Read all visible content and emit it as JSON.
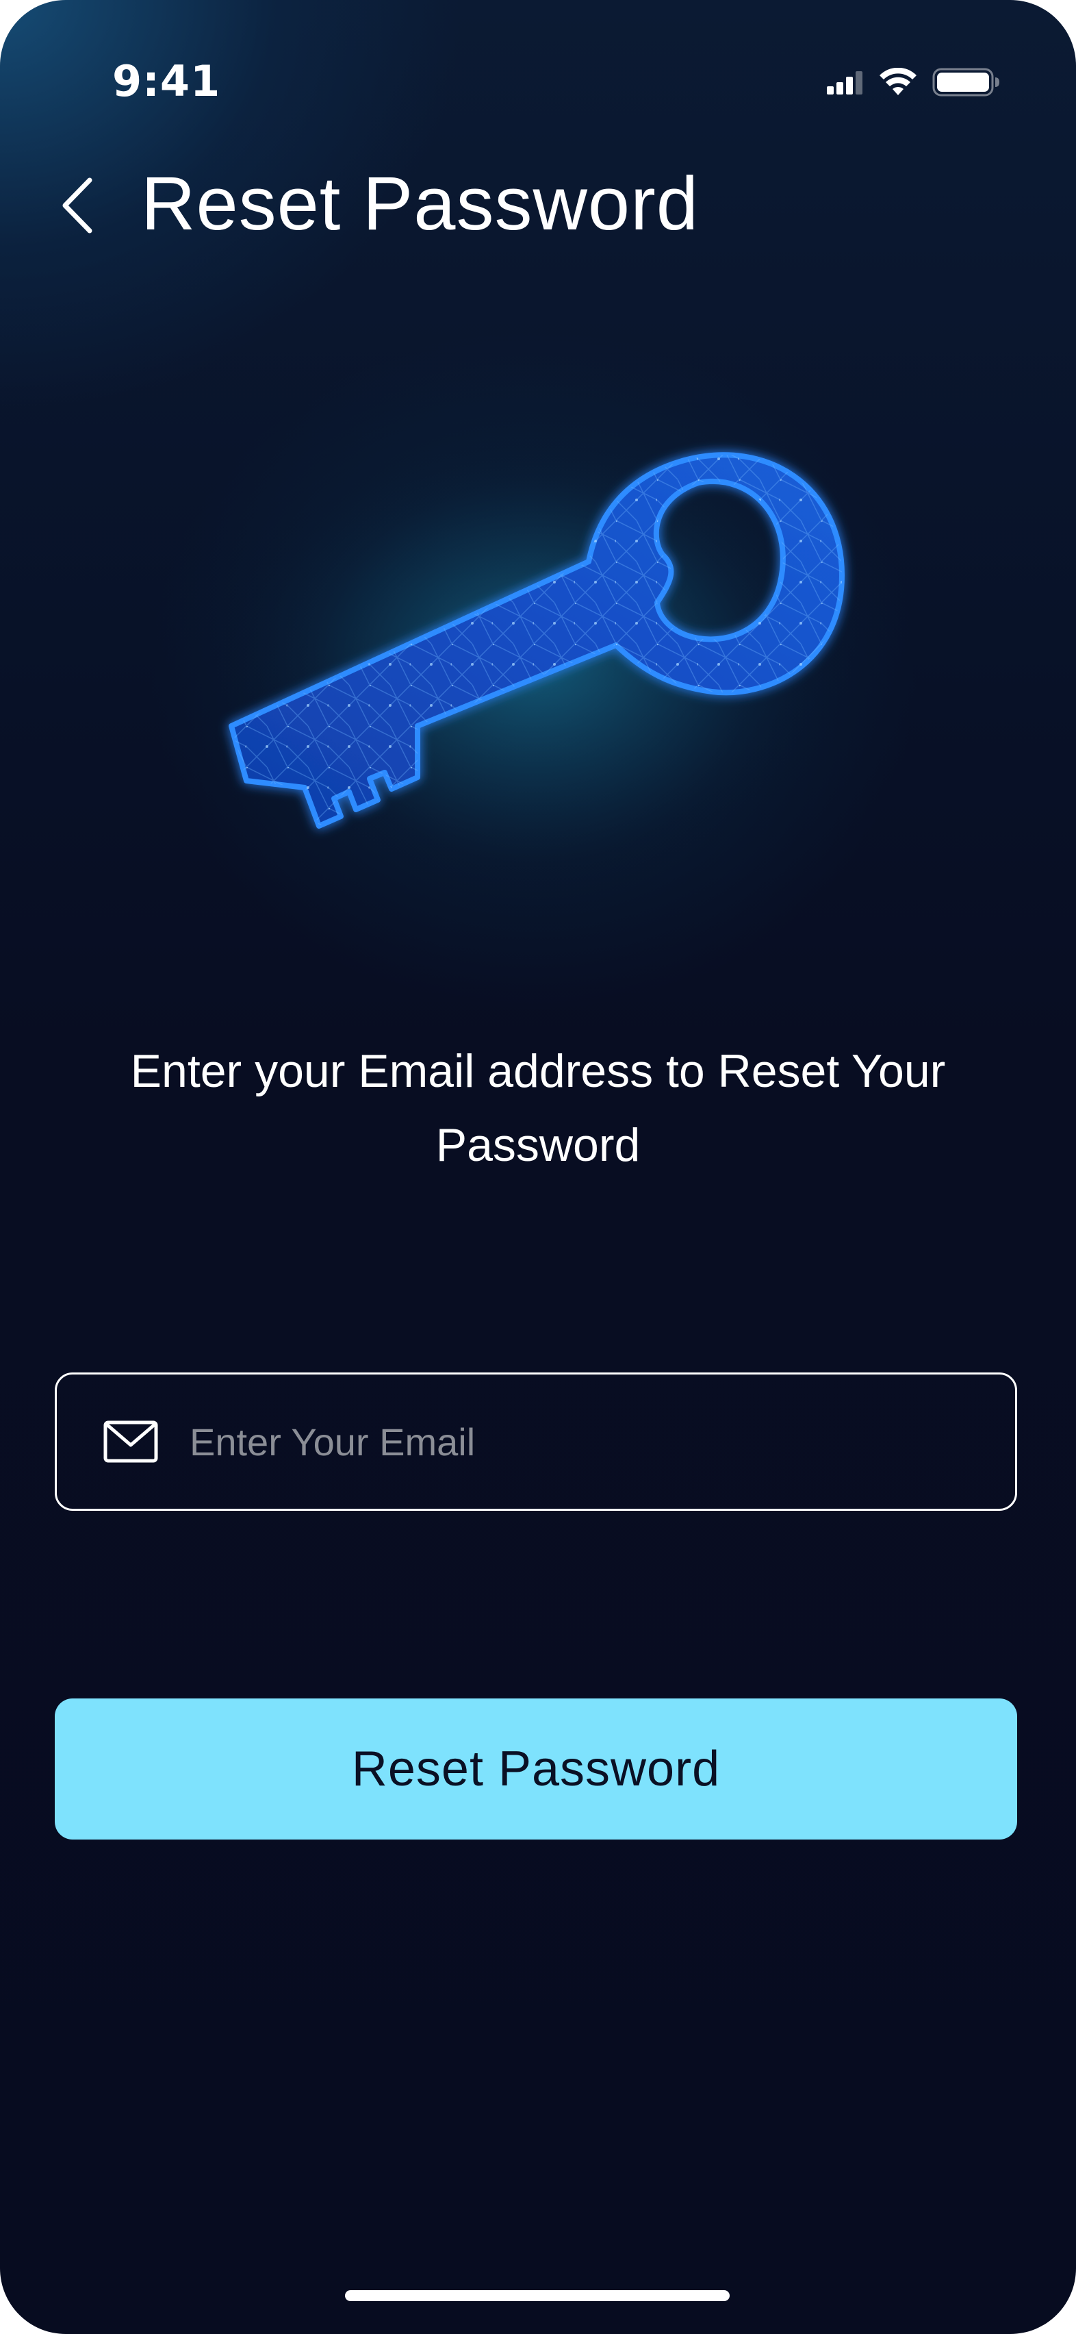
{
  "status_bar": {
    "time": "9:41",
    "icons": [
      "signal-icon",
      "wifi-icon",
      "battery-icon"
    ]
  },
  "header": {
    "back_icon": "chevron-left-icon",
    "title": "Reset Password"
  },
  "illustration": {
    "icon": "key-icon",
    "glow_color": "#1e7bff"
  },
  "instruction": {
    "text": "Enter your Email address to Reset Your Password"
  },
  "email_field": {
    "icon": "mail-icon",
    "value": "",
    "placeholder": "Enter Your Email"
  },
  "reset_button": {
    "label": "Reset Password",
    "color": "#7ee2fd"
  },
  "colors": {
    "background": "#070c20",
    "accent": "#7ee2fd",
    "text": "#ffffff",
    "placeholder": "#8b8e96"
  }
}
